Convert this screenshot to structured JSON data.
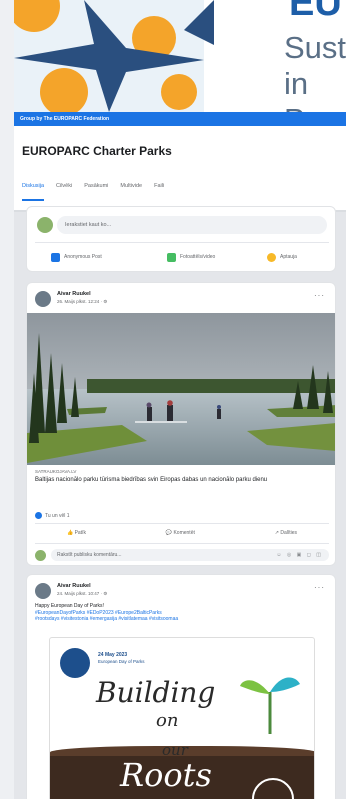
{
  "cover": {
    "line1": "Susta",
    "line2": "in Pr",
    "accent": "#1d5ea8",
    "star_color": "#2a4f7f",
    "sun_color": "#f4a42a"
  },
  "group_bar": "Group by The EUROPARC Federation",
  "group": {
    "title": "EUROPARC Charter Parks",
    "tabs": [
      "Diskusija",
      "Cilvēki",
      "Pasākumi",
      "Multivide",
      "Faili"
    ],
    "active_tab": "Diskusija"
  },
  "composer": {
    "placeholder": "Ierakstiet kaut ko...",
    "actions": [
      "Anonymous Post",
      "Fotoattēls/video",
      "Aptauja"
    ]
  },
  "post1": {
    "author": "Aivar Ruukel",
    "meta": "26. Maijs plkst. 12:24 · ⚙",
    "link_source": "SATRAUKOJAVA.LV",
    "link_title": "Baltijas nacionālo parku tūrisma biedrības svin Eiropas dabas un nacionālo parku dienu",
    "reactions": "Tu un vēl 1",
    "buttons": [
      "Patīk",
      "Komentēt",
      "Dalīties"
    ],
    "comment_placeholder": "Rakstīt publisku komentāru..."
  },
  "post2": {
    "author": "Aivar Ruukel",
    "meta": "24. Maijs plkst. 10:47 · ⚙",
    "text": "Happy European Day of Parks!",
    "hashtags": "#EuropeanDayofParks #EDoP2023 #Europe2BalticParks",
    "hashtags2": "#rootsdays #visitestonia #emergasija #visitlatemaa #visitsoomaa",
    "image": {
      "date": "24 May 2023",
      "subtitle": "European Day of Parks",
      "word1": "Building",
      "word2": "on",
      "word3": "our",
      "word4": "Roots"
    }
  }
}
